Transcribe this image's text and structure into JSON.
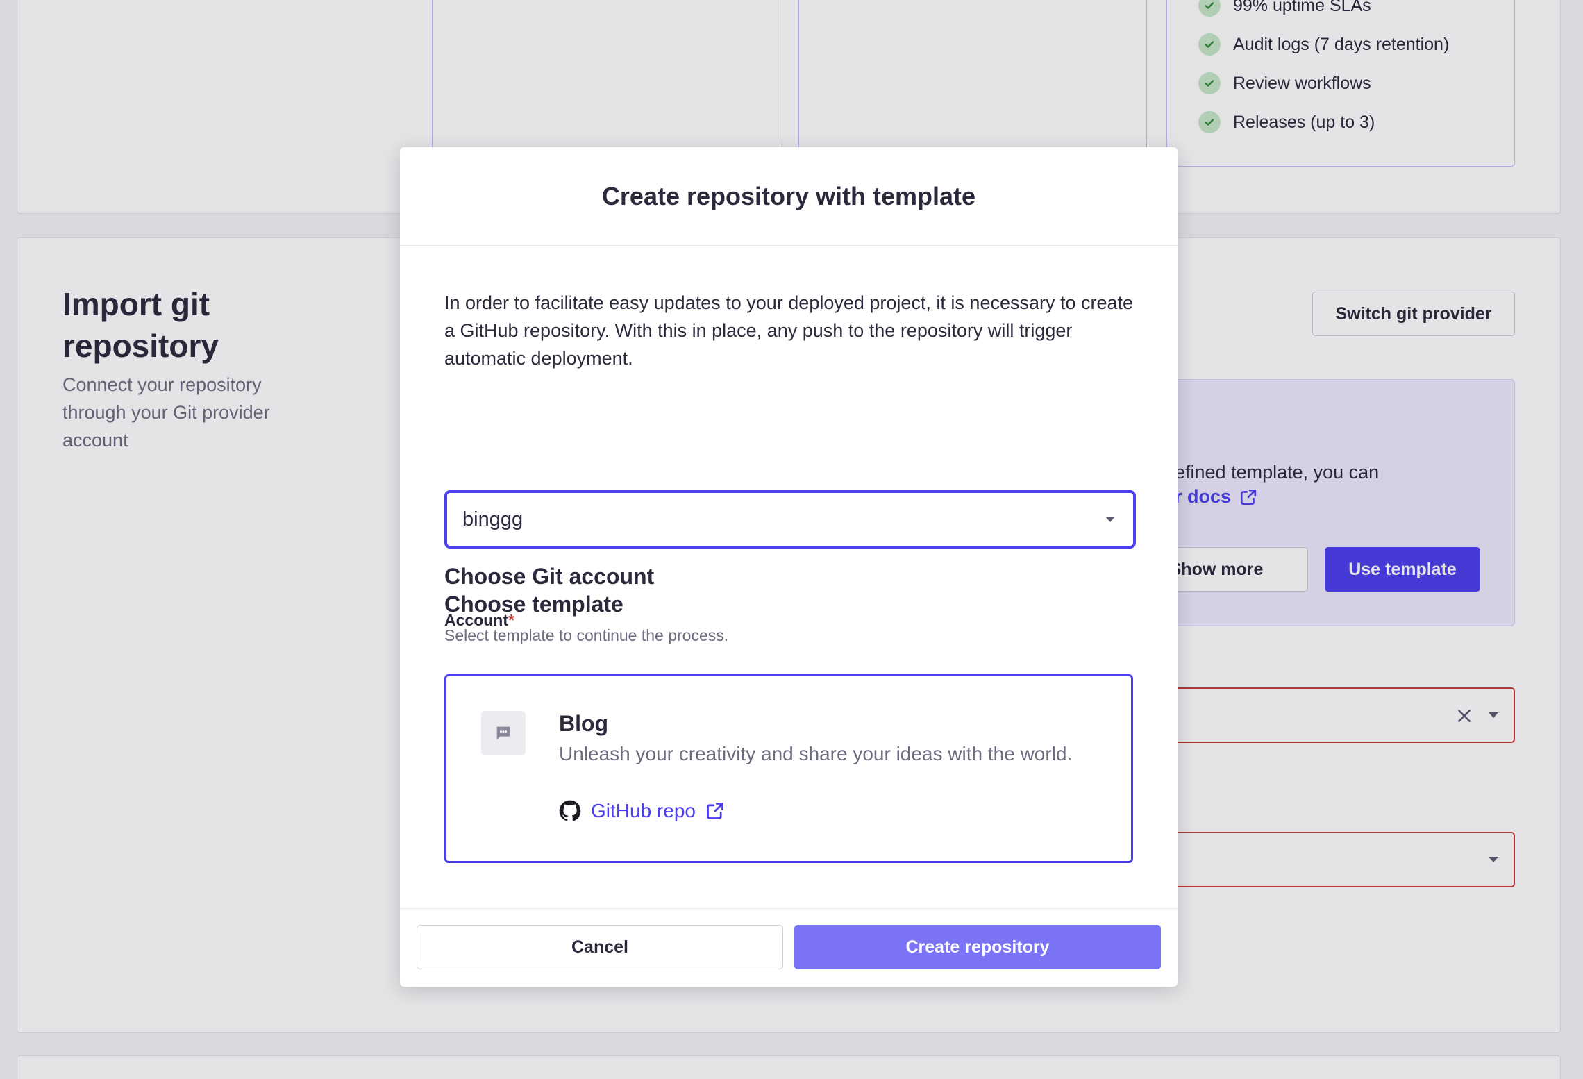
{
  "background": {
    "features": [
      "99% uptime SLAs",
      "Audit logs (7 days retention)",
      "Review workflows",
      "Releases (up to 3)"
    ],
    "import_section": {
      "title": "Import git repository",
      "description": "Connect your repository through your Git provider account"
    },
    "switch_provider_label": "Switch git provider",
    "template_panel": {
      "text": "efined template, you can",
      "docs_link": "r docs",
      "show_more_label": "Show more",
      "use_template_label": "Use template"
    }
  },
  "modal": {
    "title": "Create repository with template",
    "intro": "In order to facilitate easy updates to your deployed project, it is necessary to create a GitHub repository. With this in place, any push to the repository will trigger automatic deployment.",
    "git_account": {
      "section_title": "Choose Git account",
      "label": "Account",
      "required_mark": "*",
      "value": "binggg"
    },
    "template": {
      "section_title": "Choose template",
      "subtitle": "Select template to continue the process.",
      "card": {
        "name": "Blog",
        "description": "Unleash your creativity and share your ideas with the world.",
        "link_label": "GitHub repo"
      }
    },
    "footer": {
      "cancel_label": "Cancel",
      "create_label": "Create repository"
    }
  },
  "colors": {
    "accent": "#4c3ff0",
    "accent_disabled": "#7a73f5",
    "error": "#c83a3a",
    "success": "#2e8a3b"
  },
  "icons": [
    "check-icon",
    "chat-bubble-icon",
    "github-icon",
    "external-link-icon",
    "close-icon",
    "chevron-down-icon"
  ]
}
